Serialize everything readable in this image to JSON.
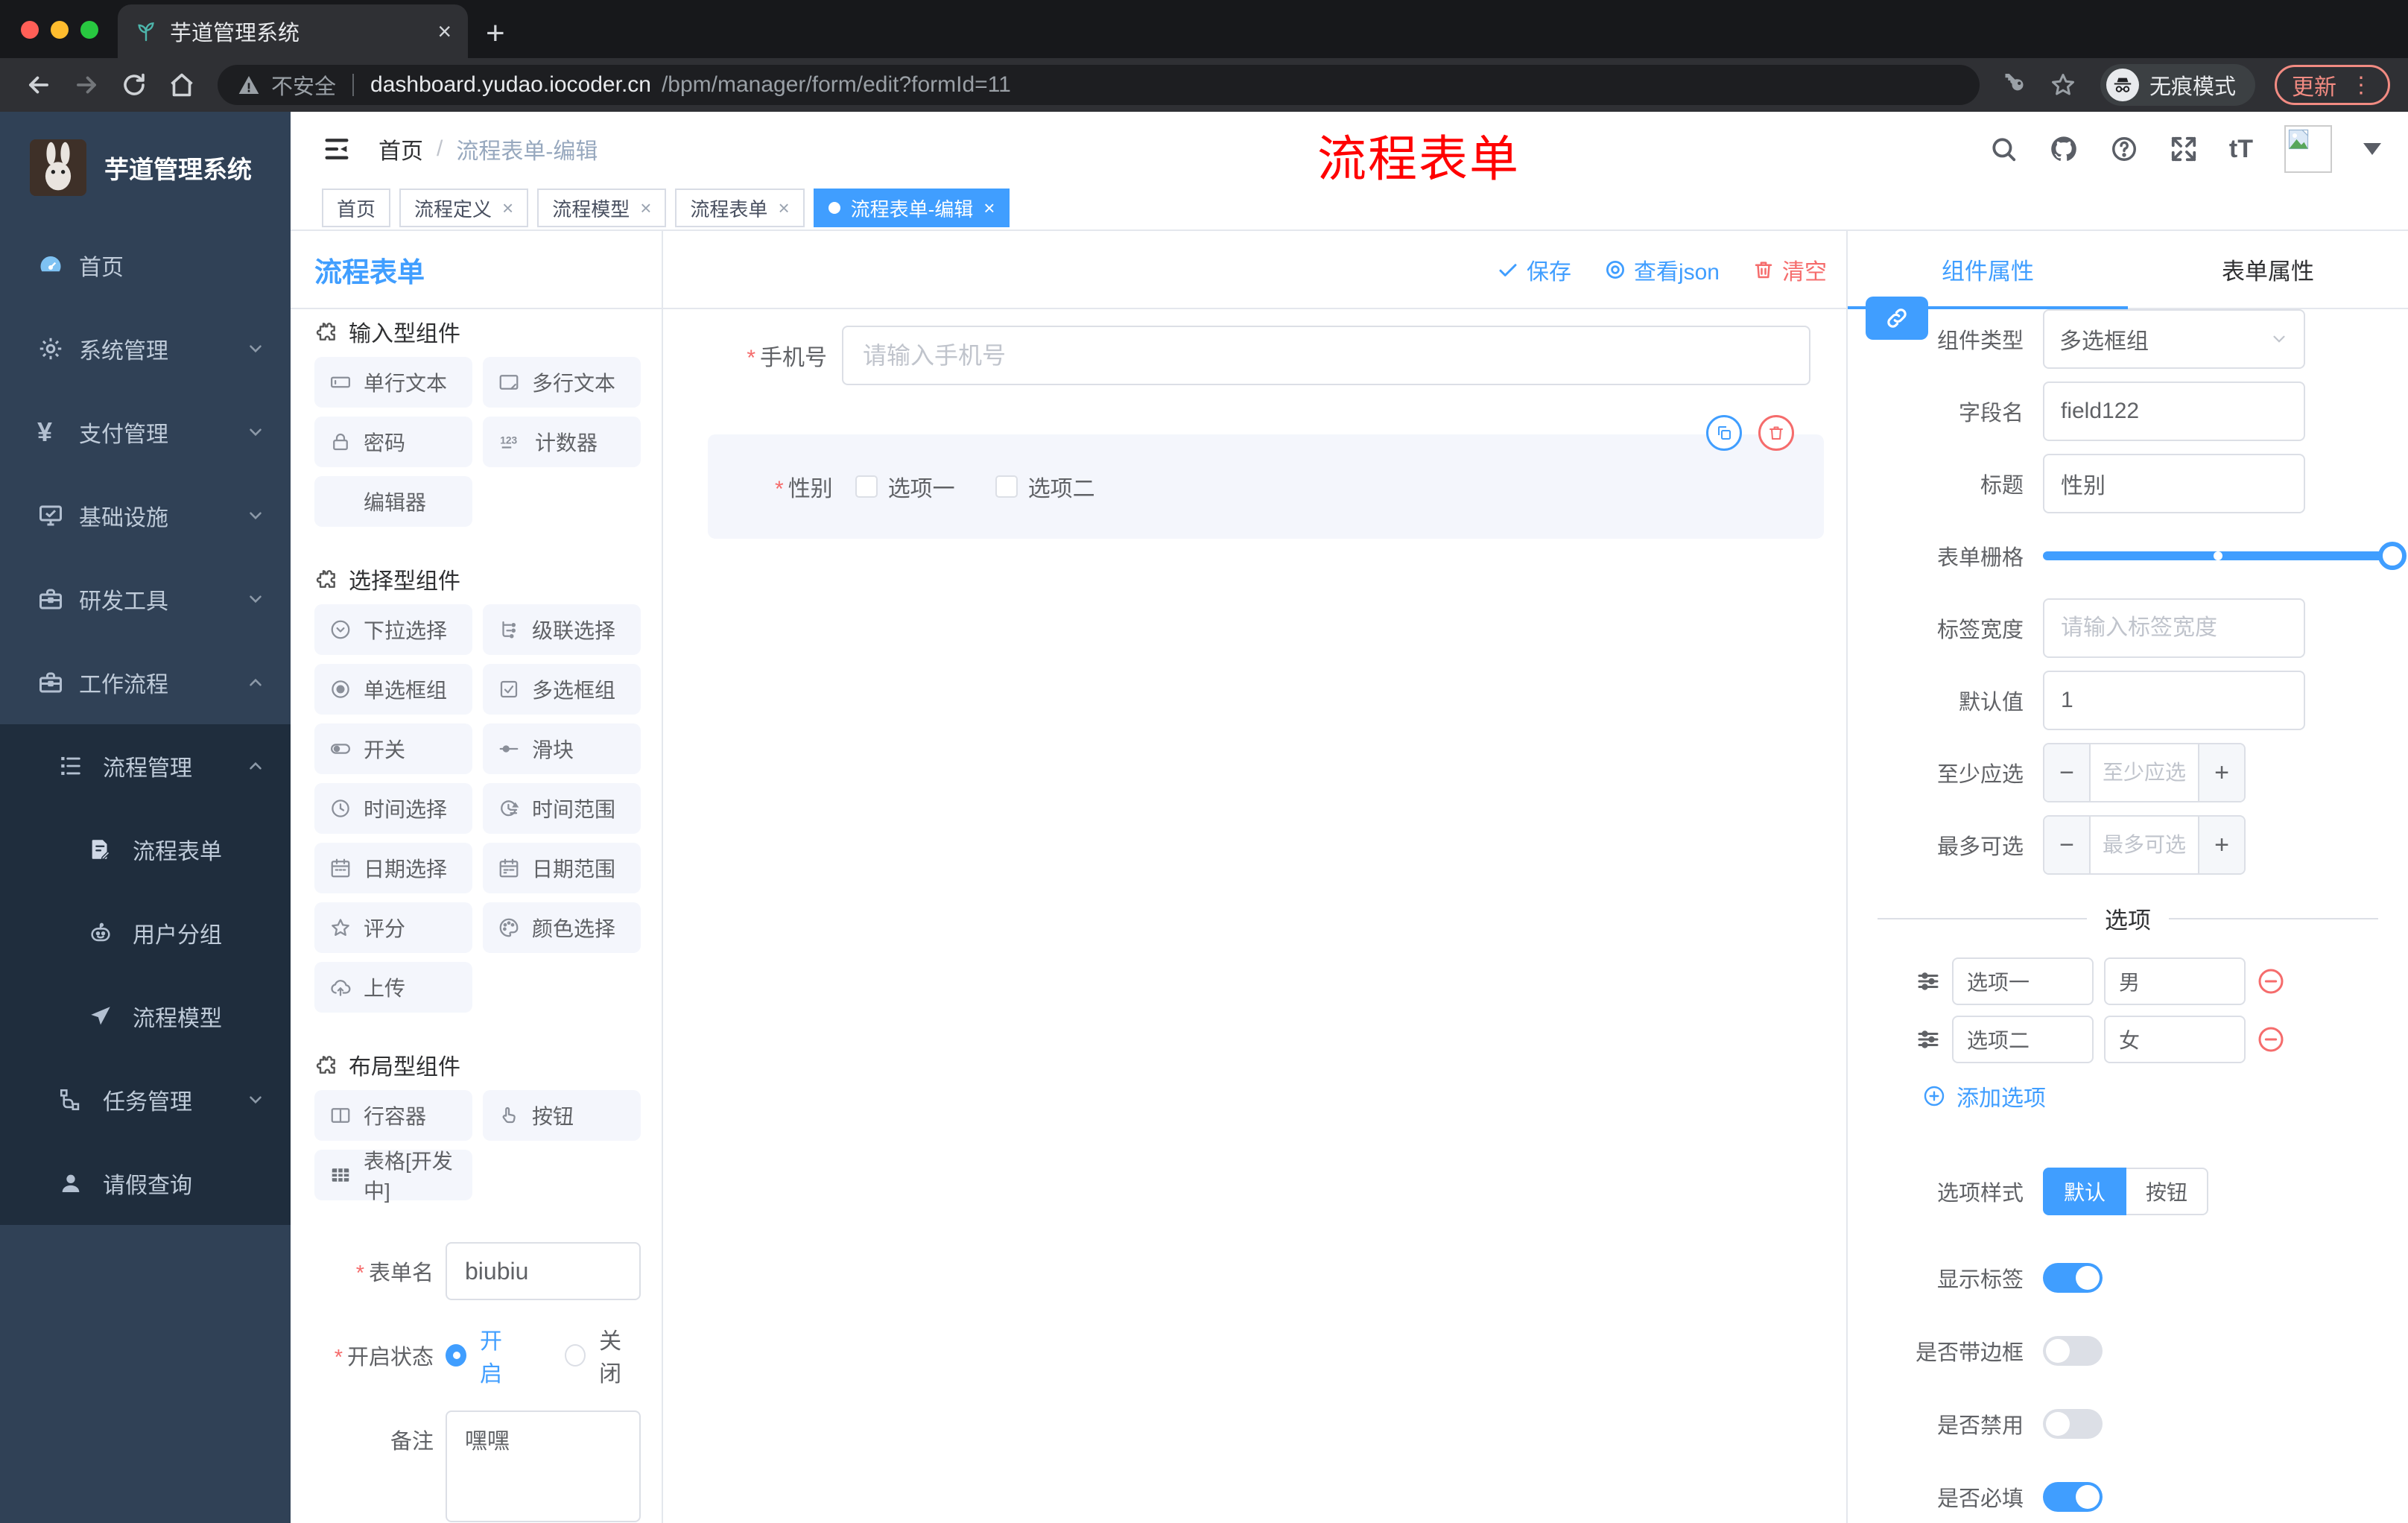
{
  "colors": {
    "primary": "#409eff",
    "danger": "#f56c6c",
    "annotation_red": "#ff0000",
    "sidebar_bg": "#304156",
    "submenu_bg": "#1f2d3d",
    "chip_bg": "#f4f6fc",
    "active_tab_bg": "#409eff"
  },
  "misc": {
    "required": "*",
    "counter_icon_text": "123",
    "font_size_icon_text": "tT"
  },
  "browser": {
    "tab_title": "芋道管理系统",
    "close_glyph": "×",
    "new_tab_glyph": "+",
    "security": "不安全",
    "domain": "dashboard.yudao.iocoder.cn",
    "path": "/bpm/manager/form/edit?formId=11",
    "incognito": "无痕模式",
    "update": "更新",
    "menu_glyph": "⋮"
  },
  "sidebar": {
    "logo": "芋道管理系统",
    "home": "首页",
    "system": "系统管理",
    "pay": "支付管理",
    "infra": "基础设施",
    "dev": "研发工具",
    "workflow": "工作流程",
    "process": "流程管理",
    "form": "流程表单",
    "group": "用户分组",
    "model": "流程模型",
    "task": "任务管理",
    "leave": "请假查询"
  },
  "header": {
    "breadcrumb_home": "首页",
    "breadcrumb_sep": "/",
    "breadcrumb_current": "流程表单-编辑",
    "annotation": "流程表单"
  },
  "tags": {
    "t0": "首页",
    "t1": "流程定义",
    "t2": "流程模型",
    "t3": "流程表单",
    "t4": "流程表单-编辑"
  },
  "left": {
    "title": "流程表单",
    "g1_title": "输入型组件",
    "g1i1": "单行文本",
    "g1i2": "多行文本",
    "g1i3": "密码",
    "g1i4": "计数器",
    "g1i5": "编辑器",
    "g2_title": "选择型组件",
    "g2i1": "下拉选择",
    "g2i2": "级联选择",
    "g2i3": "单选框组",
    "g2i4": "多选框组",
    "g2i5": "开关",
    "g2i6": "滑块",
    "g2i7": "时间选择",
    "g2i8": "时间范围",
    "g2i9": "日期选择",
    "g2i10": "日期范围",
    "g2i11": "评分",
    "g2i12": "颜色选择",
    "g2i13": "上传",
    "g3_title": "布局型组件",
    "g3i1": "行容器",
    "g3i2": "按钮",
    "g3i3": "表格[开发中]",
    "form_name_label": "表单名",
    "form_name_value": "biubiu",
    "status_label": "开启状态",
    "status_on": "开启",
    "status_off": "关闭",
    "remark_label": "备注",
    "remark_value": "嘿嘿"
  },
  "canvas": {
    "save": "保存",
    "view_json": "查看json",
    "clear": "清空",
    "phone_label": "手机号",
    "phone_placeholder": "请输入手机号",
    "gender_label": "性别",
    "gender_opt1": "选项一",
    "gender_opt2": "选项二"
  },
  "panel": {
    "tab_component": "组件属性",
    "tab_form": "表单属性",
    "type_label": "组件类型",
    "type_value": "多选框组",
    "field_label": "字段名",
    "field_value": "field122",
    "title_label": "标题",
    "title_value": "性别",
    "grid_label": "表单栅格",
    "width_label": "标签宽度",
    "width_placeholder": "请输入标签宽度",
    "default_label": "默认值",
    "default_value": "1",
    "min_label": "至少应选",
    "min_placeholder": "至少应选",
    "max_label": "最多可选",
    "max_placeholder": "最多可选",
    "minus": "−",
    "plus": "+",
    "options_title": "选项",
    "opt1_label": "选项一",
    "opt1_value": "男",
    "opt2_label": "选项二",
    "opt2_value": "女",
    "add_option": "添加选项",
    "style_label": "选项样式",
    "style_default": "默认",
    "style_button": "按钮",
    "show_label": "显示标签",
    "border_label": "是否带边框",
    "disabled_label": "是否禁用",
    "required_label": "是否必填"
  }
}
